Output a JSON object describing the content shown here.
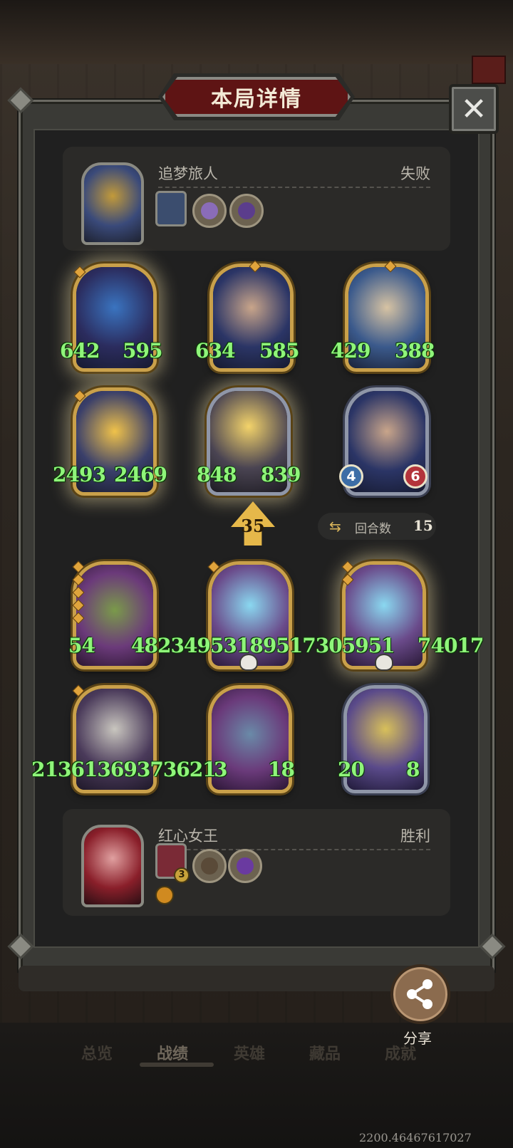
{
  "dialog": {
    "title": "本局详情",
    "close_label": "✕"
  },
  "player_top": {
    "name": "追梦旅人",
    "result": "失败"
  },
  "player_bottom": {
    "name": "红心女王",
    "result": "胜利",
    "slot_badge": "3"
  },
  "top_board": {
    "row1": [
      {
        "atk": "642",
        "hp": "595"
      },
      {
        "atk": "634",
        "hp": "585"
      },
      {
        "atk": "429",
        "hp": "388"
      }
    ],
    "row2": [
      {
        "atk": "2493",
        "hp": "2469"
      },
      {
        "atk": "848",
        "hp": "839"
      },
      {
        "atk": "4",
        "hp": "6"
      }
    ]
  },
  "bottom_board": {
    "row1_stats": [
      "54",
      "48234953189517305951",
      "74017"
    ],
    "row2": [
      {
        "stat": "21361369373621"
      },
      {
        "atk": "3",
        "hp": "18"
      },
      {
        "atk": "20",
        "hp": "8"
      }
    ]
  },
  "damage_indicator": "35",
  "rounds": {
    "label": "回合数",
    "value": "15"
  },
  "share_label": "分享",
  "nav": {
    "items": [
      "总览",
      "战绩",
      "英雄",
      "藏品",
      "成就"
    ],
    "active": "战绩"
  },
  "coordinate_readout": "2200.46467617027",
  "colors": {
    "title_plate": "#5e1414",
    "stat_green": "#8ff57a",
    "gold_frame": "#c9a04a"
  }
}
